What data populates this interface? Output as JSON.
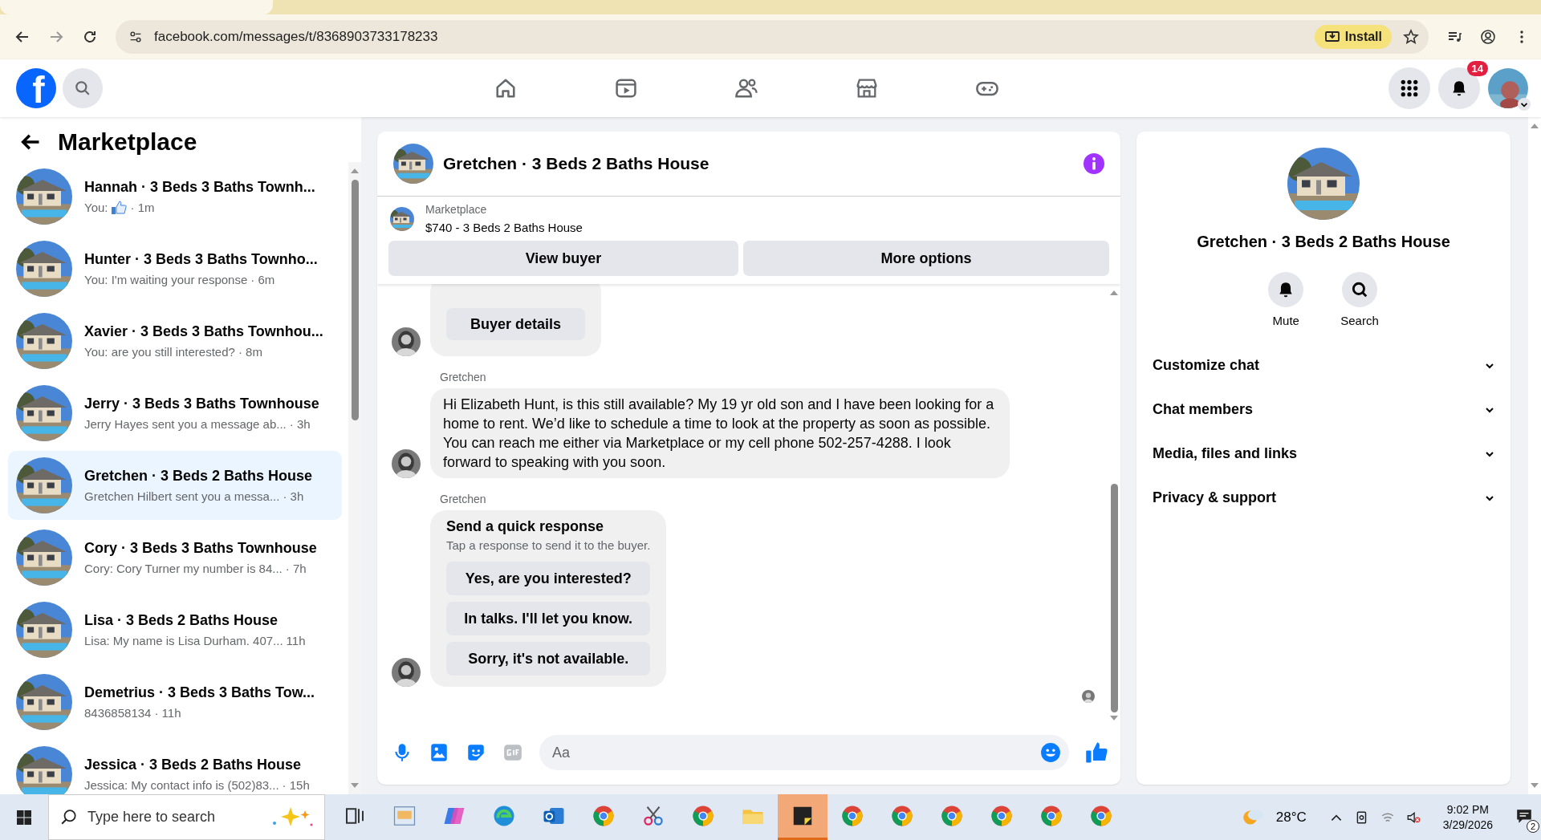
{
  "browser": {
    "url": "facebook.com/messages/t/8368903733178233",
    "install_label": "Install"
  },
  "header": {
    "logo": "f",
    "nav": [
      {
        "kind": "home"
      },
      {
        "kind": "video"
      },
      {
        "kind": "friends"
      },
      {
        "kind": "marketplace"
      },
      {
        "kind": "gaming"
      }
    ],
    "notification_count": "14"
  },
  "sidebar": {
    "title": "Marketplace",
    "conversations": [
      {
        "name": "Hannah · 3 Beds 3 Baths Townh...",
        "preview": "You:",
        "kind": "like",
        "time": "· 1m",
        "selected": false
      },
      {
        "name": "Hunter · 3 Beds 3 Baths Townho...",
        "preview": "You: I'm waiting your response",
        "kind": "text",
        "time": "· 6m",
        "selected": false
      },
      {
        "name": "Xavier · 3 Beds 3 Baths Townhou...",
        "preview": "You: are you still interested?",
        "kind": "text",
        "time": "· 8m",
        "selected": false
      },
      {
        "name": "Jerry · 3 Beds 3 Baths Townhouse",
        "preview": "Jerry Hayes sent you a message ab...",
        "kind": "text",
        "time": "· 3h",
        "selected": false
      },
      {
        "name": "Gretchen · 3 Beds 2 Baths House",
        "preview": "Gretchen Hilbert sent you a messa...",
        "kind": "text",
        "time": "· 3h",
        "selected": true
      },
      {
        "name": "Cory · 3 Beds 3 Baths Townhouse",
        "preview": "Cory: Cory Turner my number is 84...",
        "kind": "text",
        "time": "· 7h",
        "selected": false
      },
      {
        "name": "Lisa · 3 Beds 2 Baths House",
        "preview": "Lisa: My name is Lisa Durham. 407...",
        "kind": "text",
        "time": "11h",
        "selected": false
      },
      {
        "name": "Demetrius · 3 Beds 3 Baths Tow...",
        "preview": "8436858134",
        "kind": "text",
        "time": "· 11h",
        "selected": false
      },
      {
        "name": "Jessica · 3 Beds 2 Baths House",
        "preview": "Jessica: My contact info is (502)83...",
        "kind": "text",
        "time": "· 15h",
        "selected": false
      }
    ]
  },
  "chat": {
    "title": "Gretchen · 3 Beds 2 Baths House",
    "listing": {
      "source": "Marketplace",
      "summary": "$740 - 3 Beds 2 Baths House"
    },
    "actions": [
      "View buyer",
      "More options"
    ],
    "messages": [
      {
        "kind": "card",
        "button": "Buyer details"
      },
      {
        "kind": "text",
        "sender": "Gretchen",
        "text": "Hi Elizabeth Hunt, is this still available? My 19 yr old son and I have been looking for a home to rent. We’d like to schedule a time to look at the property as soon as possible. You can reach me either via Marketplace or my cell phone 502-257-4288. I look forward to speaking with you soon."
      },
      {
        "kind": "quick",
        "sender": "Gretchen",
        "title": "Send a quick response",
        "hint": "Tap a response to send it to the buyer.",
        "options": [
          "Yes, are you interested?",
          "In talks. I'll let you know.",
          "Sorry, it's not available."
        ]
      }
    ],
    "composer": {
      "placeholder": "Aa"
    }
  },
  "details": {
    "title": "Gretchen · 3 Beds 2 Baths House",
    "actions": [
      {
        "kind": "bell",
        "label": "Mute"
      },
      {
        "kind": "search",
        "label": "Search"
      }
    ],
    "sections": [
      {
        "label": "Customize chat",
        "expanded": false
      },
      {
        "label": "Chat members",
        "expanded": false
      },
      {
        "label": "Media, files and links",
        "expanded": false
      },
      {
        "label": "Privacy & support",
        "expanded": false
      }
    ]
  },
  "taskbar": {
    "search_placeholder": "Type here to search",
    "apps": [
      {
        "kind": "taskview",
        "active": false
      },
      {
        "kind": "widget",
        "active": false
      },
      {
        "kind": "copilot",
        "active": false
      },
      {
        "kind": "edge",
        "active": false
      },
      {
        "kind": "outlook",
        "active": false
      },
      {
        "kind": "chrome",
        "active": false
      },
      {
        "kind": "snip",
        "active": false
      },
      {
        "kind": "chrome",
        "active": false
      },
      {
        "kind": "folder",
        "active": false
      },
      {
        "kind": "notes",
        "active": true
      },
      {
        "kind": "chrome",
        "active": false
      },
      {
        "kind": "chrome",
        "active": false
      },
      {
        "kind": "chrome",
        "active": false
      },
      {
        "kind": "chrome",
        "active": false
      },
      {
        "kind": "chrome",
        "active": false
      },
      {
        "kind": "chrome",
        "active": false
      }
    ],
    "temperature": "28°C",
    "time": "9:02 PM",
    "date": "3/29/2026",
    "notifications": "2"
  }
}
